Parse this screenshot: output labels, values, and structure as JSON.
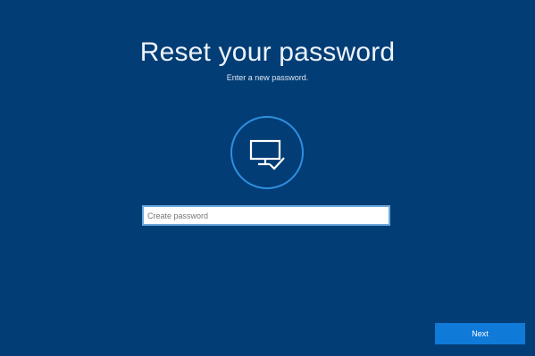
{
  "colors": {
    "background": "#033d75",
    "accent": "#0f7ad8",
    "ring": "#2f8fe0"
  },
  "header": {
    "title": "Reset your password",
    "subtitle": "Enter a new password."
  },
  "icon": {
    "name": "monitor-check-icon"
  },
  "password_field": {
    "value": "",
    "placeholder": "Create password"
  },
  "footer": {
    "next_label": "Next"
  }
}
